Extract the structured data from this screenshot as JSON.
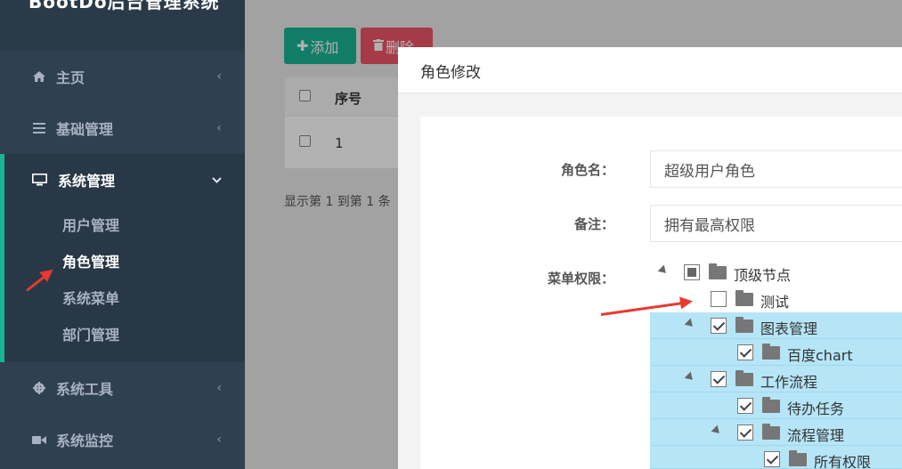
{
  "app": {
    "title": "BootDo后台管理系统"
  },
  "sidebar": {
    "items": [
      {
        "label": "主页",
        "icon": "home-icon"
      },
      {
        "label": "基础管理",
        "icon": "list-icon"
      },
      {
        "label": "系统管理",
        "icon": "monitor-icon",
        "active": true
      },
      {
        "label": "系统工具",
        "icon": "gear-icon"
      },
      {
        "label": "系统监控",
        "icon": "video-icon"
      }
    ],
    "submenu": [
      {
        "label": "用户管理"
      },
      {
        "label": "角色管理",
        "current": true
      },
      {
        "label": "系统菜单"
      },
      {
        "label": "部门管理"
      }
    ]
  },
  "toolbar": {
    "add_label": "添加",
    "delete_label": "删除"
  },
  "table": {
    "columns": [
      "序号"
    ],
    "rows": [
      [
        "1"
      ]
    ],
    "pager": "显示第 1 到第 1 条"
  },
  "modal": {
    "title": "角色修改",
    "fields": {
      "role_name_label": "角色名：",
      "role_name_value": "超级用户角色",
      "remark_label": "备注：",
      "remark_value": "拥有最高权限",
      "menu_perm_label": "菜单权限："
    },
    "tree": [
      {
        "label": "顶级节点",
        "state": "partial",
        "level": 0,
        "expander": true,
        "highlight": false
      },
      {
        "label": "测试",
        "state": "unchecked",
        "level": 1,
        "expander": false,
        "highlight": false
      },
      {
        "label": "图表管理",
        "state": "checked",
        "level": 1,
        "expander": true,
        "highlight": true
      },
      {
        "label": "百度chart",
        "state": "checked",
        "level": 2,
        "expander": false,
        "highlight": true
      },
      {
        "label": "工作流程",
        "state": "checked",
        "level": 1,
        "expander": true,
        "highlight": true
      },
      {
        "label": "待办任务",
        "state": "checked",
        "level": 2,
        "expander": false,
        "highlight": true
      },
      {
        "label": "流程管理",
        "state": "checked",
        "level": 2,
        "expander": true,
        "highlight": true
      },
      {
        "label": "所有权限",
        "state": "checked",
        "level": 3,
        "expander": false,
        "highlight": true
      }
    ]
  },
  "colors": {
    "sidebar_bg": "#2f4050",
    "accent": "#1ab394",
    "danger": "#ed5565",
    "tree_highlight": "#b5e5f6",
    "arrow": "#e8392f"
  }
}
